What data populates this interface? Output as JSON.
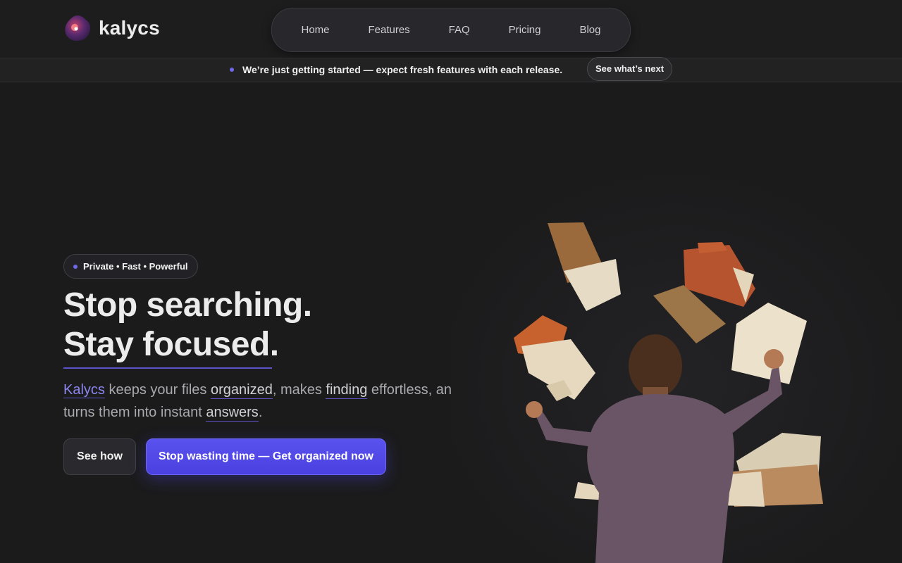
{
  "header": {
    "logo_text": "kalycs",
    "nav": [
      {
        "label": "Home"
      },
      {
        "label": "Features"
      },
      {
        "label": "FAQ"
      },
      {
        "label": "Pricing"
      },
      {
        "label": "Blog"
      }
    ]
  },
  "announcement": {
    "text": "We’re just getting started — expect fresh features with each release.",
    "button_label": "See what’s next"
  },
  "hero": {
    "badge": "Private • Fast • Powerful",
    "headline_line1": "Stop searching.",
    "headline_line2": "Stay focused.",
    "sub": {
      "brand": "Kalycs",
      "t1": " keeps your files ",
      "w1": "organized",
      "t2": ", makes ",
      "w2": "finding",
      "t3": " effortless, and turns them into instant ",
      "w3": "answers",
      "t4": "."
    },
    "secondary_button": "See how",
    "primary_button": "Stop wasting time — Get organized now"
  },
  "colors": {
    "background": "#1b1b1c",
    "accent": "#5a52ee",
    "underline": "#5a54c8"
  },
  "icons": {
    "logo": "kalycs-logo-icon",
    "illustration": "man-with-flying-folders-illustration"
  }
}
